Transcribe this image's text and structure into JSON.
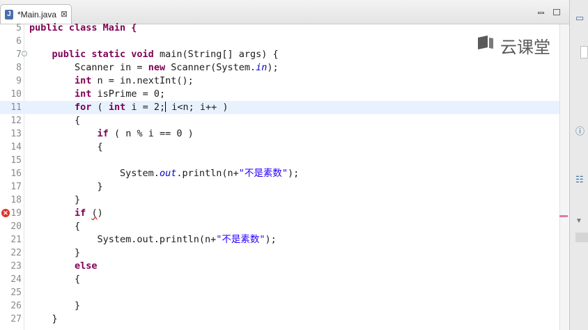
{
  "tab": {
    "icon": "java-file-icon",
    "label": "*Main.java",
    "close": "⊠"
  },
  "watermark": {
    "text": "云课堂"
  },
  "editor": {
    "lines": [
      {
        "num": "5",
        "segs": [
          {
            "t": "public class Main {",
            "c": "kw"
          }
        ]
      },
      {
        "num": "6",
        "segs": []
      },
      {
        "num": "7",
        "fold": true,
        "segs": [
          {
            "t": "    "
          },
          {
            "t": "public static void",
            "c": "kw"
          },
          {
            "t": " main(String[] args) {"
          }
        ]
      },
      {
        "num": "8",
        "segs": [
          {
            "t": "        Scanner in = "
          },
          {
            "t": "new",
            "c": "kw"
          },
          {
            "t": " Scanner(System."
          },
          {
            "t": "in",
            "c": "it"
          },
          {
            "t": ");"
          }
        ]
      },
      {
        "num": "9",
        "segs": [
          {
            "t": "        "
          },
          {
            "t": "int",
            "c": "kw"
          },
          {
            "t": " n = in.nextInt();"
          }
        ]
      },
      {
        "num": "10",
        "segs": [
          {
            "t": "        "
          },
          {
            "t": "int",
            "c": "kw"
          },
          {
            "t": " isPrime = 0;"
          }
        ]
      },
      {
        "num": "11",
        "current": true,
        "segs": [
          {
            "t": "        "
          },
          {
            "t": "for",
            "c": "kw"
          },
          {
            "t": " ( "
          },
          {
            "t": "int",
            "c": "kw"
          },
          {
            "t": " i = 2;"
          },
          {
            "t": "",
            "c": "caret"
          },
          {
            "t": " i<n; i++ )"
          }
        ]
      },
      {
        "num": "12",
        "segs": [
          {
            "t": "        {"
          }
        ]
      },
      {
        "num": "13",
        "segs": [
          {
            "t": "            "
          },
          {
            "t": "if",
            "c": "kw"
          },
          {
            "t": " ( n % i == 0 )"
          }
        ]
      },
      {
        "num": "14",
        "segs": [
          {
            "t": "            {"
          }
        ]
      },
      {
        "num": "15",
        "segs": []
      },
      {
        "num": "16",
        "segs": [
          {
            "t": "                System."
          },
          {
            "t": "out",
            "c": "it"
          },
          {
            "t": ".println(n+"
          },
          {
            "t": "\"不是素数\"",
            "c": "str"
          },
          {
            "t": ");"
          }
        ]
      },
      {
        "num": "17",
        "segs": [
          {
            "t": "            }"
          }
        ]
      },
      {
        "num": "18",
        "segs": [
          {
            "t": "        }"
          }
        ]
      },
      {
        "num": "19",
        "error": true,
        "segs": [
          {
            "t": "        "
          },
          {
            "t": "if",
            "c": "kw"
          },
          {
            "t": " "
          },
          {
            "t": "(",
            "c": "squig"
          },
          {
            "t": ")"
          }
        ]
      },
      {
        "num": "20",
        "segs": [
          {
            "t": "        {"
          }
        ]
      },
      {
        "num": "21",
        "segs": [
          {
            "t": "            System.out.println(n+"
          },
          {
            "t": "\"不是素数\"",
            "c": "str"
          },
          {
            "t": ");"
          }
        ]
      },
      {
        "num": "22",
        "segs": [
          {
            "t": "        }"
          }
        ]
      },
      {
        "num": "23",
        "segs": [
          {
            "t": "        "
          },
          {
            "t": "else",
            "c": "kw"
          }
        ]
      },
      {
        "num": "24",
        "segs": [
          {
            "t": "        {"
          }
        ]
      },
      {
        "num": "25",
        "segs": []
      },
      {
        "num": "26",
        "segs": [
          {
            "t": "        }"
          }
        ]
      },
      {
        "num": "27",
        "segs": [
          {
            "t": "    }"
          }
        ]
      }
    ]
  }
}
